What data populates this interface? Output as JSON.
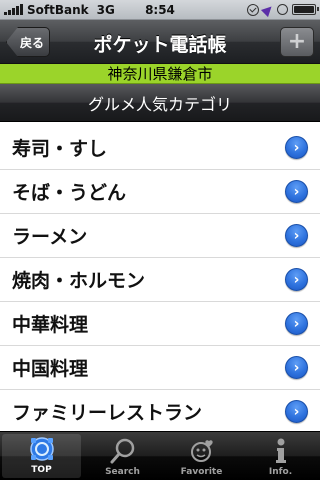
{
  "status_bar": {
    "carrier": "SoftBank",
    "network": "3G",
    "time": "8:54"
  },
  "nav": {
    "back_label": "戻る",
    "title": "ポケット電話帳",
    "add_label": "+"
  },
  "region": "神奈川県鎌倉市",
  "category_header": "グルメ人気カテゴリ",
  "list": {
    "items": [
      {
        "label": "寿司・すし"
      },
      {
        "label": "そば・うどん"
      },
      {
        "label": "ラーメン"
      },
      {
        "label": "焼肉・ホルモン"
      },
      {
        "label": "中華料理"
      },
      {
        "label": "中国料理"
      },
      {
        "label": "ファミリーレストラン"
      }
    ],
    "disclosure_glyph": "›"
  },
  "tab_bar": {
    "tabs": [
      {
        "label": "TOP",
        "icon": "top-icon",
        "active": true
      },
      {
        "label": "Search",
        "icon": "search-icon",
        "active": false
      },
      {
        "label": "Favorite",
        "icon": "favorite-icon",
        "active": false
      },
      {
        "label": "Info.",
        "icon": "info-icon",
        "active": false
      }
    ]
  },
  "colors": {
    "region_bar": "#9bd42a",
    "disclosure": "#2f73de"
  }
}
